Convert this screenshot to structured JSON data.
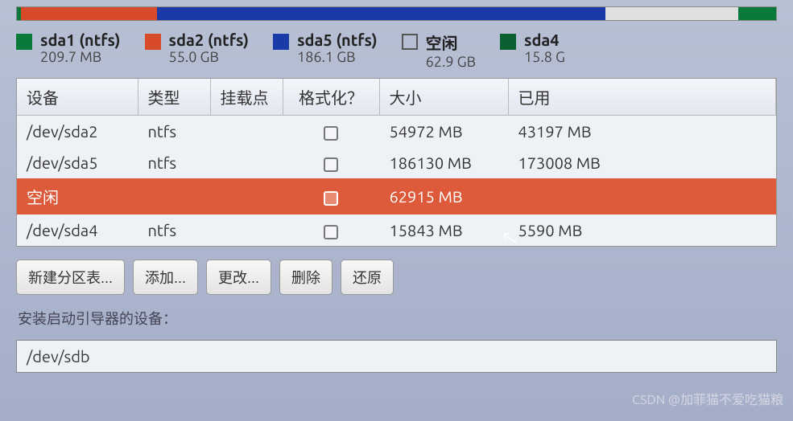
{
  "legend": [
    {
      "name": "sda1 (ntfs)",
      "size": "209.7 MB",
      "swatch": "filled-green"
    },
    {
      "name": "sda2 (ntfs)",
      "size": "55.0 GB",
      "swatch": "filled-red"
    },
    {
      "name": "sda5 (ntfs)",
      "size": "186.1 GB",
      "swatch": "filled-blue"
    },
    {
      "name": "空闲",
      "size": "62.9 GB",
      "swatch": "outline"
    },
    {
      "name": "sda4",
      "size": "15.8 G",
      "swatch": "filled-dkgreen"
    }
  ],
  "headers": {
    "device": "设备",
    "type": "类型",
    "mount": "挂载点",
    "format": "格式化？",
    "size": "大小",
    "used": "已用"
  },
  "rows": [
    {
      "device": "/dev/sda2",
      "type": "ntfs",
      "mount": "",
      "size": "54972 MB",
      "used": "43197 MB",
      "selected": false
    },
    {
      "device": "/dev/sda5",
      "type": "ntfs",
      "mount": "",
      "size": "186130 MB",
      "used": "173008 MB",
      "selected": false
    },
    {
      "device": "空闲",
      "type": "",
      "mount": "",
      "size": "62915 MB",
      "used": "",
      "selected": true
    },
    {
      "device": "/dev/sda4",
      "type": "ntfs",
      "mount": "",
      "size": "15843 MB",
      "used": "5590 MB",
      "selected": false
    }
  ],
  "buttons": {
    "new_table": "新建分区表...",
    "add": "添加...",
    "change": "更改...",
    "delete": "删除",
    "revert": "还原"
  },
  "boot_label": "安装启动引导器的设备：",
  "boot_device": "/dev/sdb",
  "watermark": "CSDN @加菲猫不爱吃猫粮"
}
